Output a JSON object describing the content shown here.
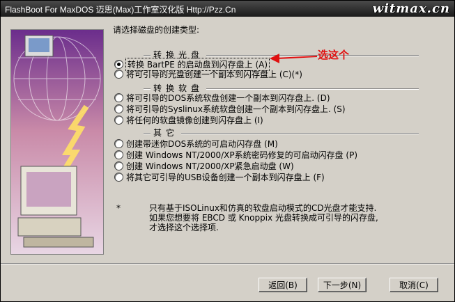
{
  "window": {
    "title": "FlashBoot For MaxDOS 迈思(Max)工作室汉化版 Http://Pzz.Cn",
    "watermark": "witmax.cn"
  },
  "intro": "请选择磁盘的创建类型:",
  "annotation": "选这个",
  "groups": [
    {
      "title": "转换光盘",
      "options": [
        {
          "label": "转换 BartPE 的启动盘到闪存盘上 (A)",
          "checked": true
        },
        {
          "label": "将可引导的光盘创建一个副本到闪存盘上 (C)(*)",
          "checked": false
        }
      ]
    },
    {
      "title": "转换软盘",
      "options": [
        {
          "label": "将可引导的DOS系统软盘创建一个副本到闪存盘上. (D)",
          "checked": false
        },
        {
          "label": "将可引导的Syslinux系统软盘创建一个副本到闪存盘上. (S)",
          "checked": false
        },
        {
          "label": "将任何的软盘镜像创建到闪存盘上 (I)",
          "checked": false
        }
      ]
    },
    {
      "title": "其它",
      "options": [
        {
          "label": "创建带迷你DOS系统的可启动闪存盘 (M)",
          "checked": false
        },
        {
          "label": "创建 Windows NT/2000/XP系统密码修复的可启动闪存盘 (P)",
          "checked": false
        },
        {
          "label": "创建 Windows NT/2000/XP紧急启动盘 (W)",
          "checked": false
        },
        {
          "label": "将其它可引导的USB设备创建一个副本到闪存盘上 (F)",
          "checked": false
        }
      ]
    }
  ],
  "note": {
    "marker": "*",
    "text": "只有基于ISOLinux和仿真的软盘启动模式的CD光盘才能支持.\n如果您想要将 EBCD 或 Knoppix 光盘转换成可引导的闪存盘,\n才选择这个选择项."
  },
  "buttons": {
    "back": "返回(B)",
    "next": "下一步(N)",
    "cancel": "取消(C)"
  },
  "colors": {
    "annotation": "#e01010",
    "titlebar": "#2a2a2a"
  }
}
